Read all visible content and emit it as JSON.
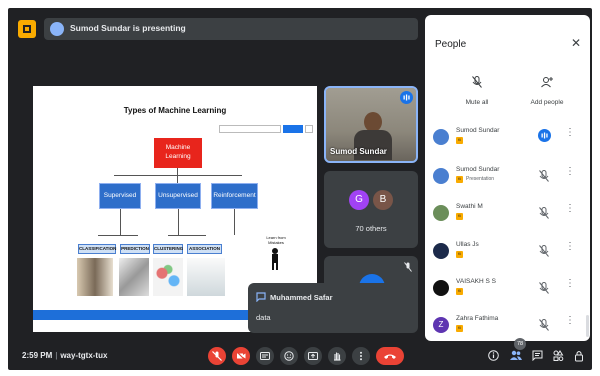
{
  "header": {
    "presenting_text": "Sumod Sundar is presenting"
  },
  "slide": {
    "title": "Types of Machine Learning",
    "root": "Machine Learning",
    "categories": [
      "Supervised",
      "Unsupervised",
      "Reinforcement"
    ],
    "subcategories": [
      "CLASSIFICATION",
      "PREDICTION",
      "CLUSTERING",
      "ASSOCIATION"
    ],
    "learn_label": "Learn from Mistakes"
  },
  "tiles": {
    "presenter_name": "Sumod Sundar",
    "others_initials": [
      "G",
      "B"
    ],
    "others_label": "70 others"
  },
  "chat": {
    "sender": "Muhammed Safar",
    "message": "data"
  },
  "people_panel": {
    "title": "People",
    "actions": {
      "mute_all": "Mute all",
      "add_people": "Add people"
    },
    "participants": [
      {
        "name": "Sumod Sundar",
        "badge": "Ki",
        "subtitle": "",
        "speaking": true,
        "avatar_color": "#4a7fd0"
      },
      {
        "name": "Sumod Sundar",
        "badge": "Ki",
        "subtitle": "Presentation",
        "speaking": false,
        "avatar_color": "#4a7fd0"
      },
      {
        "name": "Swathi M",
        "badge": "Ki",
        "subtitle": "",
        "speaking": false,
        "avatar_color": "#6b8e5a"
      },
      {
        "name": "Ullas Js",
        "badge": "Ki",
        "subtitle": "",
        "speaking": false,
        "avatar_color": "#1c2a4a"
      },
      {
        "name": "VAISAKH S S",
        "badge": "Ki",
        "subtitle": "",
        "speaking": false,
        "avatar_color": "#111111"
      },
      {
        "name": "Zahra Fathima",
        "badge": "Ki",
        "subtitle": "",
        "speaking": false,
        "avatar_color": "#5e35b1",
        "initial": "Z"
      }
    ]
  },
  "bottom_bar": {
    "time": "2:59 PM",
    "meeting_code": "way-tgtx-tux",
    "people_count": "78"
  }
}
